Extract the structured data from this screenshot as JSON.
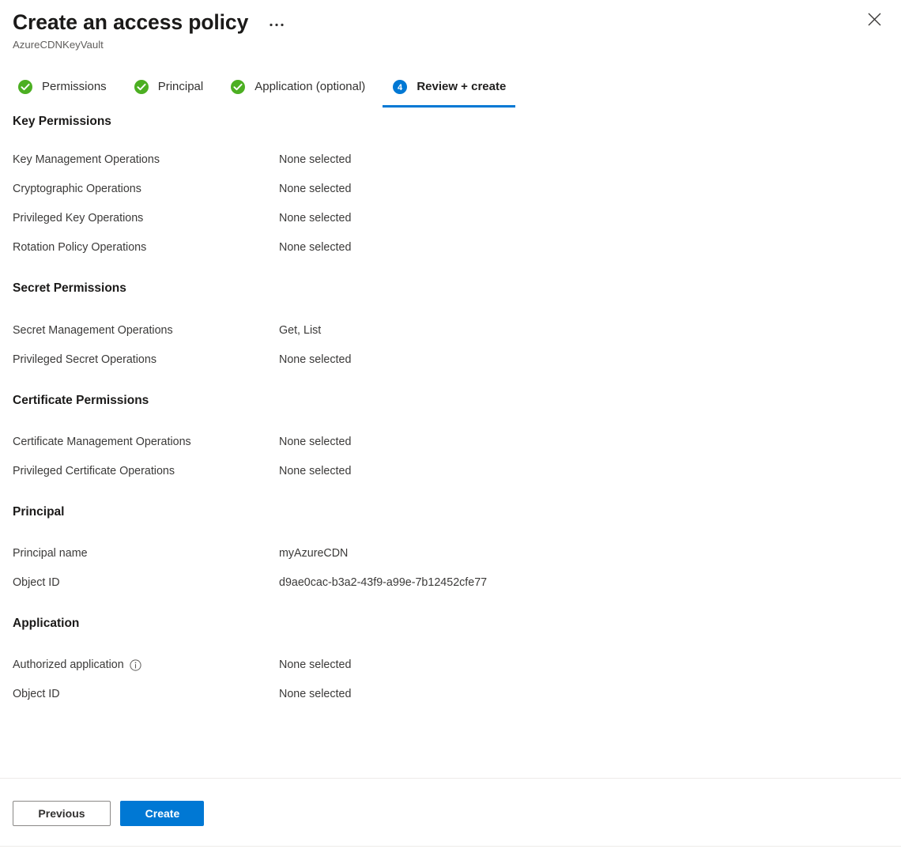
{
  "header": {
    "title": "Create an access policy",
    "subtitle": "AzureCDNKeyVault",
    "more_menu_label": "...",
    "close_label": "Close",
    "accent_color": "#0078d4",
    "success_color": "#4caf22"
  },
  "tabs": [
    {
      "label": "Permissions",
      "state": "complete",
      "icon": "check-circle-icon",
      "step": "1"
    },
    {
      "label": "Principal",
      "state": "complete",
      "icon": "check-circle-icon",
      "step": "2"
    },
    {
      "label": "Application (optional)",
      "state": "complete",
      "icon": "check-circle-icon",
      "step": "3"
    },
    {
      "label": "Review + create",
      "state": "active",
      "icon": "step-number-badge",
      "step": "4"
    }
  ],
  "sections": [
    {
      "heading": "Key Permissions",
      "rows": [
        {
          "label": "Key Management Operations",
          "value": "None selected"
        },
        {
          "label": "Cryptographic Operations",
          "value": "None selected"
        },
        {
          "label": "Privileged Key Operations",
          "value": "None selected"
        },
        {
          "label": "Rotation Policy Operations",
          "value": "None selected"
        }
      ]
    },
    {
      "heading": "Secret Permissions",
      "rows": [
        {
          "label": "Secret Management Operations",
          "value": "Get, List"
        },
        {
          "label": "Privileged Secret Operations",
          "value": "None selected"
        }
      ]
    },
    {
      "heading": "Certificate Permissions",
      "rows": [
        {
          "label": "Certificate Management Operations",
          "value": "None selected"
        },
        {
          "label": "Privileged Certificate Operations",
          "value": "None selected"
        }
      ]
    },
    {
      "heading": "Principal",
      "rows": [
        {
          "label": "Principal name",
          "value": "myAzureCDN"
        },
        {
          "label": "Object ID",
          "value": "d9ae0cac-b3a2-43f9-a99e-7b12452cfe77"
        }
      ]
    },
    {
      "heading": "Application",
      "rows": [
        {
          "label": "Authorized application",
          "value": "None selected",
          "info": true
        },
        {
          "label": "Object ID",
          "value": "None selected"
        }
      ]
    }
  ],
  "footer": {
    "previous_label": "Previous",
    "create_label": "Create"
  }
}
